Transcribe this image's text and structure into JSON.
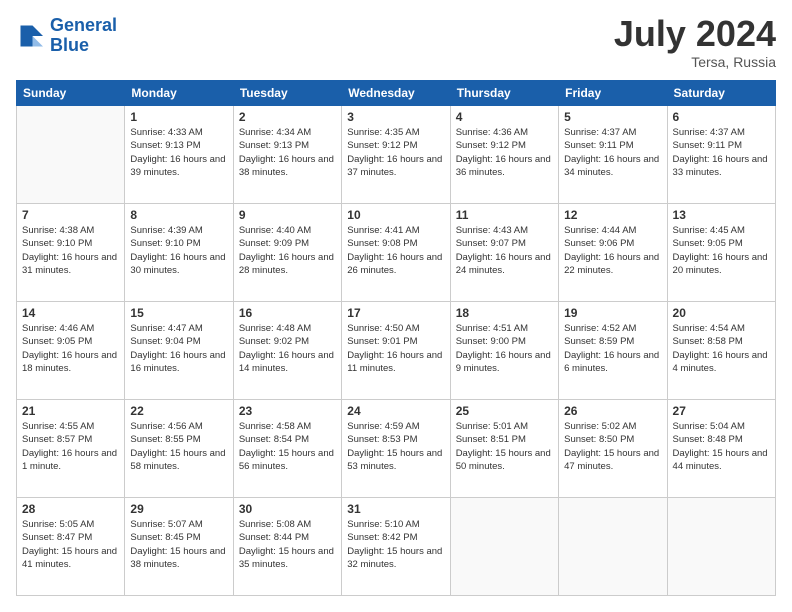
{
  "logo": {
    "line1": "General",
    "line2": "Blue"
  },
  "title": "July 2024",
  "location": "Tersa, Russia",
  "days_of_week": [
    "Sunday",
    "Monday",
    "Tuesday",
    "Wednesday",
    "Thursday",
    "Friday",
    "Saturday"
  ],
  "weeks": [
    [
      {
        "day": "",
        "sunrise": "",
        "sunset": "",
        "daylight": "",
        "empty": true
      },
      {
        "day": "1",
        "sunrise": "Sunrise: 4:33 AM",
        "sunset": "Sunset: 9:13 PM",
        "daylight": "Daylight: 16 hours and 39 minutes."
      },
      {
        "day": "2",
        "sunrise": "Sunrise: 4:34 AM",
        "sunset": "Sunset: 9:13 PM",
        "daylight": "Daylight: 16 hours and 38 minutes."
      },
      {
        "day": "3",
        "sunrise": "Sunrise: 4:35 AM",
        "sunset": "Sunset: 9:12 PM",
        "daylight": "Daylight: 16 hours and 37 minutes."
      },
      {
        "day": "4",
        "sunrise": "Sunrise: 4:36 AM",
        "sunset": "Sunset: 9:12 PM",
        "daylight": "Daylight: 16 hours and 36 minutes."
      },
      {
        "day": "5",
        "sunrise": "Sunrise: 4:37 AM",
        "sunset": "Sunset: 9:11 PM",
        "daylight": "Daylight: 16 hours and 34 minutes."
      },
      {
        "day": "6",
        "sunrise": "Sunrise: 4:37 AM",
        "sunset": "Sunset: 9:11 PM",
        "daylight": "Daylight: 16 hours and 33 minutes."
      }
    ],
    [
      {
        "day": "7",
        "sunrise": "Sunrise: 4:38 AM",
        "sunset": "Sunset: 9:10 PM",
        "daylight": "Daylight: 16 hours and 31 minutes."
      },
      {
        "day": "8",
        "sunrise": "Sunrise: 4:39 AM",
        "sunset": "Sunset: 9:10 PM",
        "daylight": "Daylight: 16 hours and 30 minutes."
      },
      {
        "day": "9",
        "sunrise": "Sunrise: 4:40 AM",
        "sunset": "Sunset: 9:09 PM",
        "daylight": "Daylight: 16 hours and 28 minutes."
      },
      {
        "day": "10",
        "sunrise": "Sunrise: 4:41 AM",
        "sunset": "Sunset: 9:08 PM",
        "daylight": "Daylight: 16 hours and 26 minutes."
      },
      {
        "day": "11",
        "sunrise": "Sunrise: 4:43 AM",
        "sunset": "Sunset: 9:07 PM",
        "daylight": "Daylight: 16 hours and 24 minutes."
      },
      {
        "day": "12",
        "sunrise": "Sunrise: 4:44 AM",
        "sunset": "Sunset: 9:06 PM",
        "daylight": "Daylight: 16 hours and 22 minutes."
      },
      {
        "day": "13",
        "sunrise": "Sunrise: 4:45 AM",
        "sunset": "Sunset: 9:05 PM",
        "daylight": "Daylight: 16 hours and 20 minutes."
      }
    ],
    [
      {
        "day": "14",
        "sunrise": "Sunrise: 4:46 AM",
        "sunset": "Sunset: 9:05 PM",
        "daylight": "Daylight: 16 hours and 18 minutes."
      },
      {
        "day": "15",
        "sunrise": "Sunrise: 4:47 AM",
        "sunset": "Sunset: 9:04 PM",
        "daylight": "Daylight: 16 hours and 16 minutes."
      },
      {
        "day": "16",
        "sunrise": "Sunrise: 4:48 AM",
        "sunset": "Sunset: 9:02 PM",
        "daylight": "Daylight: 16 hours and 14 minutes."
      },
      {
        "day": "17",
        "sunrise": "Sunrise: 4:50 AM",
        "sunset": "Sunset: 9:01 PM",
        "daylight": "Daylight: 16 hours and 11 minutes."
      },
      {
        "day": "18",
        "sunrise": "Sunrise: 4:51 AM",
        "sunset": "Sunset: 9:00 PM",
        "daylight": "Daylight: 16 hours and 9 minutes."
      },
      {
        "day": "19",
        "sunrise": "Sunrise: 4:52 AM",
        "sunset": "Sunset: 8:59 PM",
        "daylight": "Daylight: 16 hours and 6 minutes."
      },
      {
        "day": "20",
        "sunrise": "Sunrise: 4:54 AM",
        "sunset": "Sunset: 8:58 PM",
        "daylight": "Daylight: 16 hours and 4 minutes."
      }
    ],
    [
      {
        "day": "21",
        "sunrise": "Sunrise: 4:55 AM",
        "sunset": "Sunset: 8:57 PM",
        "daylight": "Daylight: 16 hours and 1 minute."
      },
      {
        "day": "22",
        "sunrise": "Sunrise: 4:56 AM",
        "sunset": "Sunset: 8:55 PM",
        "daylight": "Daylight: 15 hours and 58 minutes."
      },
      {
        "day": "23",
        "sunrise": "Sunrise: 4:58 AM",
        "sunset": "Sunset: 8:54 PM",
        "daylight": "Daylight: 15 hours and 56 minutes."
      },
      {
        "day": "24",
        "sunrise": "Sunrise: 4:59 AM",
        "sunset": "Sunset: 8:53 PM",
        "daylight": "Daylight: 15 hours and 53 minutes."
      },
      {
        "day": "25",
        "sunrise": "Sunrise: 5:01 AM",
        "sunset": "Sunset: 8:51 PM",
        "daylight": "Daylight: 15 hours and 50 minutes."
      },
      {
        "day": "26",
        "sunrise": "Sunrise: 5:02 AM",
        "sunset": "Sunset: 8:50 PM",
        "daylight": "Daylight: 15 hours and 47 minutes."
      },
      {
        "day": "27",
        "sunrise": "Sunrise: 5:04 AM",
        "sunset": "Sunset: 8:48 PM",
        "daylight": "Daylight: 15 hours and 44 minutes."
      }
    ],
    [
      {
        "day": "28",
        "sunrise": "Sunrise: 5:05 AM",
        "sunset": "Sunset: 8:47 PM",
        "daylight": "Daylight: 15 hours and 41 minutes."
      },
      {
        "day": "29",
        "sunrise": "Sunrise: 5:07 AM",
        "sunset": "Sunset: 8:45 PM",
        "daylight": "Daylight: 15 hours and 38 minutes."
      },
      {
        "day": "30",
        "sunrise": "Sunrise: 5:08 AM",
        "sunset": "Sunset: 8:44 PM",
        "daylight": "Daylight: 15 hours and 35 minutes."
      },
      {
        "day": "31",
        "sunrise": "Sunrise: 5:10 AM",
        "sunset": "Sunset: 8:42 PM",
        "daylight": "Daylight: 15 hours and 32 minutes."
      },
      {
        "day": "",
        "sunrise": "",
        "sunset": "",
        "daylight": "",
        "empty": true
      },
      {
        "day": "",
        "sunrise": "",
        "sunset": "",
        "daylight": "",
        "empty": true
      },
      {
        "day": "",
        "sunrise": "",
        "sunset": "",
        "daylight": "",
        "empty": true
      }
    ]
  ]
}
